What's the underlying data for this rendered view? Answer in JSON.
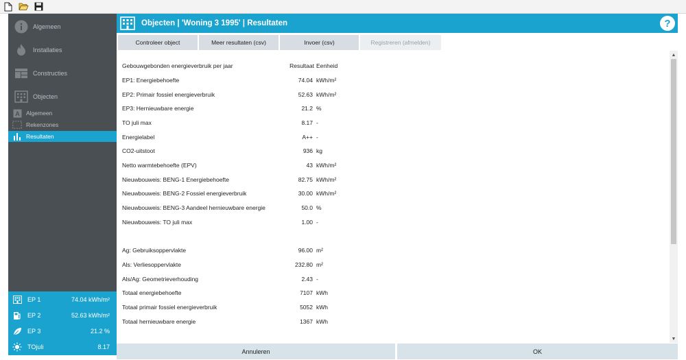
{
  "toolbar": {
    "icons": [
      "new-file-icon",
      "open-folder-icon",
      "save-icon"
    ]
  },
  "sidebar": {
    "main_items": [
      {
        "label": "Algemeen",
        "icon": "info-icon"
      },
      {
        "label": "Installaties",
        "icon": "flame-icon"
      },
      {
        "label": "Constructies",
        "icon": "construction-icon"
      },
      {
        "label": "Objecten",
        "icon": "building-icon"
      }
    ],
    "sub_items": [
      {
        "label": "Algemeen",
        "icon": "letter-a-icon",
        "active": false
      },
      {
        "label": "Rekenzones",
        "icon": "zones-icon",
        "active": false
      },
      {
        "label": "Resultaten",
        "icon": "bar-chart-icon",
        "active": true
      }
    ]
  },
  "summary": [
    {
      "label": "EP 1",
      "value": "74.04 kWh/m²",
      "icon": "building-icon"
    },
    {
      "label": "EP 2",
      "value": "52.63 kWh/m²",
      "icon": "fuel-pump-icon"
    },
    {
      "label": "EP 3",
      "value": "21.2 %",
      "icon": "leaf-icon"
    },
    {
      "label": "TOjuli",
      "value": "8.17",
      "icon": "sun-icon"
    }
  ],
  "header": {
    "title": "Objecten | 'Woning 3 1995' | Resultaten",
    "help_label": "?"
  },
  "tabs": [
    {
      "label": "Controleer object",
      "enabled": true
    },
    {
      "label": "Meer resultaten (csv)",
      "enabled": true
    },
    {
      "label": "Invoer (csv)",
      "enabled": true
    },
    {
      "label": "Registreren (afmelden)",
      "enabled": false
    }
  ],
  "results": {
    "header": {
      "label": "Gebouwgebonden energieverbruik per jaar",
      "value": "Resultaat",
      "unit": "Eenheid"
    },
    "group1": [
      {
        "label": "EP1: Energiebehoefte",
        "value": "74.04",
        "unit": "kWh/m²"
      },
      {
        "label": "EP2: Primair fossiel energieverbruik",
        "value": "52.63",
        "unit": "kWh/m²"
      },
      {
        "label": "EP3: Hernieuwbare energie",
        "value": "21.2",
        "unit": "%"
      },
      {
        "label": "TO juli max",
        "value": "8.17",
        "unit": "-"
      },
      {
        "label": "Energielabel",
        "value": "A++",
        "unit": "-"
      },
      {
        "label": "CO2-uitstoot",
        "value": "936",
        "unit": "kg"
      },
      {
        "label": "Netto warmtebehoefte (EPV)",
        "value": "43",
        "unit": "kWh/m²"
      },
      {
        "label": "Nieuwbouweis: BENG-1 Energiebehoefte",
        "value": "82.75",
        "unit": "kWh/m²"
      },
      {
        "label": "Nieuwbouweis: BENG-2 Fossiel energieverbruik",
        "value": "30.00",
        "unit": "kWh/m²"
      },
      {
        "label": "Nieuwbouweis: BENG-3 Aandeel hernieuwbare energie",
        "value": "50.0",
        "unit": "%"
      },
      {
        "label": "Nieuwbouweis: TO juli max",
        "value": "1.00",
        "unit": "-"
      }
    ],
    "group2": [
      {
        "label": "Ag: Gebruiksoppervlakte",
        "value": "96.00",
        "unit": "m²"
      },
      {
        "label": "Als: Verliesoppervlakte",
        "value": "232.80",
        "unit": "m²"
      },
      {
        "label": "Als/Ag: Geometrieverhouding",
        "value": "2.43",
        "unit": "-"
      },
      {
        "label": "Totaal energiebehoefte",
        "value": "7107",
        "unit": "kWh"
      },
      {
        "label": "Totaal primair fossiel energieverbruik",
        "value": "5052",
        "unit": "kWh"
      },
      {
        "label": "Totaal hernieuwbare energie",
        "value": "1367",
        "unit": "kWh"
      }
    ]
  },
  "footer": {
    "cancel_label": "Annuleren",
    "ok_label": "OK"
  },
  "colors": {
    "accent": "#1ba3cf",
    "sidebar": "#4a4f54",
    "tab": "#d7dde2"
  }
}
